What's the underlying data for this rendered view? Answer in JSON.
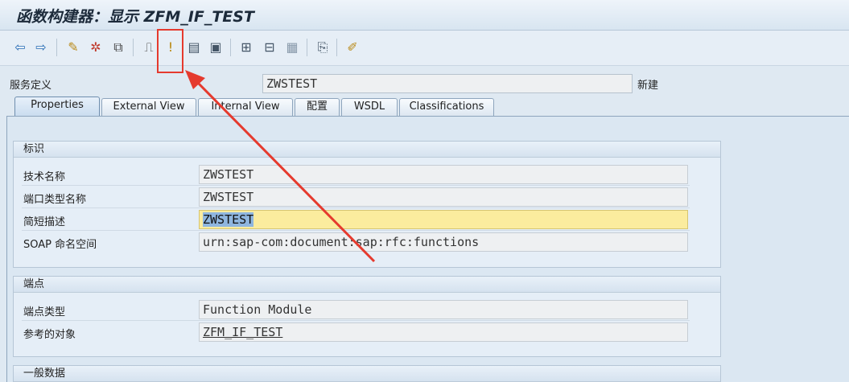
{
  "window": {
    "title": "函数构建器：显示 ZFM_IF_TEST"
  },
  "toolbar": {
    "buttons": [
      {
        "name": "back-icon",
        "glyph": "⇦",
        "color": "#2a6db5"
      },
      {
        "name": "forward-icon",
        "glyph": "⇨",
        "color": "#2a6db5"
      },
      {
        "name": "edit-pencil-icon",
        "glyph": "✎",
        "color": "#b98a18"
      },
      {
        "name": "settings-icon",
        "glyph": "✲",
        "color": "#c0392b"
      },
      {
        "name": "copy-object-icon",
        "glyph": "⧉",
        "color": "#444444"
      },
      {
        "name": "hierarchy-icon",
        "glyph": "⎍",
        "color": "#555555"
      },
      {
        "name": "activate-icon",
        "glyph": "!",
        "color": "#b8860b"
      },
      {
        "name": "layout-icon",
        "glyph": "▤",
        "color": "#445566"
      },
      {
        "name": "display-object-icon",
        "glyph": "▣",
        "color": "#445566"
      },
      {
        "name": "tree-icon",
        "glyph": "⊞",
        "color": "#445566"
      },
      {
        "name": "bookmark-icon",
        "glyph": "⊟",
        "color": "#445566"
      },
      {
        "name": "table-icon",
        "glyph": "▦",
        "color": "#8899aa"
      },
      {
        "name": "clipboard-icon",
        "glyph": "⎘",
        "color": "#445566"
      },
      {
        "name": "help-edit-icon",
        "glyph": "✐",
        "color": "#b98a18"
      }
    ]
  },
  "service": {
    "label": "服务定义",
    "value": "ZWSTEST",
    "status": "新建"
  },
  "tabs": [
    {
      "label": "Properties",
      "active": true
    },
    {
      "label": "External View",
      "active": false
    },
    {
      "label": "Internal View",
      "active": false
    },
    {
      "label": "配置",
      "active": false
    },
    {
      "label": "WSDL",
      "active": false
    },
    {
      "label": "Classifications",
      "active": false
    }
  ],
  "groups": {
    "identity": {
      "title": "标识",
      "rows": [
        {
          "label": "技术名称",
          "value": "ZWSTEST"
        },
        {
          "label": "端口类型名称",
          "value": "ZWSTEST"
        },
        {
          "label": "简短描述",
          "value": "ZWSTEST"
        },
        {
          "label": "SOAP 命名空间",
          "value": "urn:sap-com:document:sap:rfc:functions"
        }
      ]
    },
    "endpoint": {
      "title": "端点",
      "rows": [
        {
          "label": "端点类型",
          "value": "Function Module"
        },
        {
          "label": "参考的对象",
          "value": "ZFM_IF_TEST"
        }
      ]
    },
    "general": {
      "title": "一般数据"
    }
  },
  "colors": {
    "highlight": "#e53a2e",
    "edit_field": "#fbec9e"
  }
}
